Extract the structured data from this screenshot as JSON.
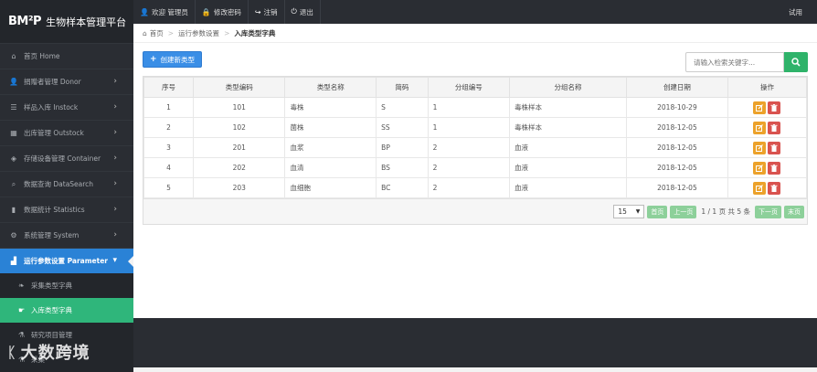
{
  "brand": {
    "logo": "BM²P",
    "name": "生物样本管理平台"
  },
  "sidebar": {
    "items": [
      {
        "icon": "home-icon",
        "glyph": "⌂",
        "label": "首页 Home",
        "chevron": false
      },
      {
        "icon": "user-icon",
        "glyph": "👤",
        "label": "捐赠者管理 Donor",
        "chevron": true
      },
      {
        "icon": "list-icon",
        "glyph": "☰",
        "label": "样品入库 Instock",
        "chevron": true
      },
      {
        "icon": "grid-icon",
        "glyph": "▦",
        "label": "出库管理 Outstock",
        "chevron": true
      },
      {
        "icon": "tag-icon",
        "glyph": "◈",
        "label": "存储设备管理 Container",
        "chevron": true
      },
      {
        "icon": "search-icon",
        "glyph": "⌕",
        "label": "数据查询 DataSearch",
        "chevron": true
      },
      {
        "icon": "bar-chart-icon",
        "glyph": "▮",
        "label": "数据统计 Statistics",
        "chevron": true
      },
      {
        "icon": "gear-icon",
        "glyph": "⚙",
        "label": "系统管理 System",
        "chevron": true
      },
      {
        "icon": "signal-icon",
        "glyph": "▟",
        "label": "运行参数设置 Parameter",
        "chevron": true,
        "active": true
      }
    ],
    "subitems": [
      {
        "icon": "leaf-icon",
        "glyph": "❧",
        "label": "采集类型字典"
      },
      {
        "icon": "hand-icon",
        "glyph": "☛",
        "label": "入库类型字典",
        "current": true
      },
      {
        "icon": "flask-icon",
        "glyph": "⚗",
        "label": "研究项目管理"
      },
      {
        "icon": "flask-icon",
        "glyph": "⚗",
        "label": "采集"
      }
    ]
  },
  "topbar": {
    "links": [
      {
        "icon": "user-icon",
        "glyph": "👤",
        "label": "欢迎 管理员"
      },
      {
        "icon": "lock-icon",
        "glyph": "🔒",
        "label": "修改密码"
      },
      {
        "icon": "logout-icon",
        "glyph": "↪",
        "label": "注销"
      },
      {
        "icon": "power-icon",
        "glyph": "⏻",
        "label": "退出"
      }
    ],
    "right_label": "试用"
  },
  "breadcrumb": {
    "home": "首页",
    "section": "运行参数设置",
    "current": "入库类型字典"
  },
  "toolbar": {
    "create_label": "创建新类型",
    "search_placeholder": "请输入检索关键字..."
  },
  "table": {
    "headers": [
      "序号",
      "类型编码",
      "类型名称",
      "简码",
      "分组编号",
      "分组名称",
      "创建日期",
      "操作"
    ],
    "rows": [
      [
        "1",
        "101",
        "毒株",
        "S",
        "1",
        "毒株样本",
        "2018-10-29"
      ],
      [
        "2",
        "102",
        "菌株",
        "SS",
        "1",
        "毒株样本",
        "2018-12-05"
      ],
      [
        "3",
        "201",
        "血浆",
        "BP",
        "2",
        "血液",
        "2018-12-05"
      ],
      [
        "4",
        "202",
        "血清",
        "BS",
        "2",
        "血液",
        "2018-12-05"
      ],
      [
        "5",
        "203",
        "血细胞",
        "BC",
        "2",
        "血液",
        "2018-12-05"
      ]
    ]
  },
  "pager": {
    "page_size": "15",
    "first": "首页",
    "prev": "上一页",
    "info": "1 / 1 页 共 5 条",
    "next": "下一页",
    "last": "末页"
  },
  "watermark": {
    "text": "大数跨境"
  },
  "colors": {
    "sidebar_bg": "#2a2d33",
    "active_blue": "#2a82d6",
    "current_green": "#2fb67b",
    "edit_orange": "#eca22b",
    "delete_red": "#d9534f"
  }
}
